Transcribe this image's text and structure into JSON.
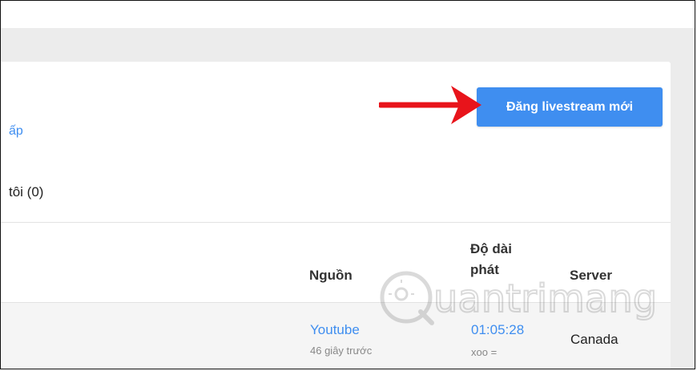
{
  "header": {
    "post_button_label": "Đăng livestream mới"
  },
  "card": {
    "partial_link": "ấp",
    "count_label": "tôi (0)"
  },
  "table": {
    "columns": {
      "source": "Nguồn",
      "duration": [
        "Độ dài",
        "phát"
      ],
      "server": "Server"
    },
    "rows": [
      {
        "source": "Youtube",
        "time_ago": "46 giây trước",
        "duration": "01:05:28",
        "duration_sub": "xoo =",
        "server": "Canada"
      }
    ]
  },
  "watermark": {
    "text": "uantrimang"
  },
  "colors": {
    "accent": "#3f8ef0",
    "arrow": "#e8141b",
    "page_bg": "#ececec"
  }
}
